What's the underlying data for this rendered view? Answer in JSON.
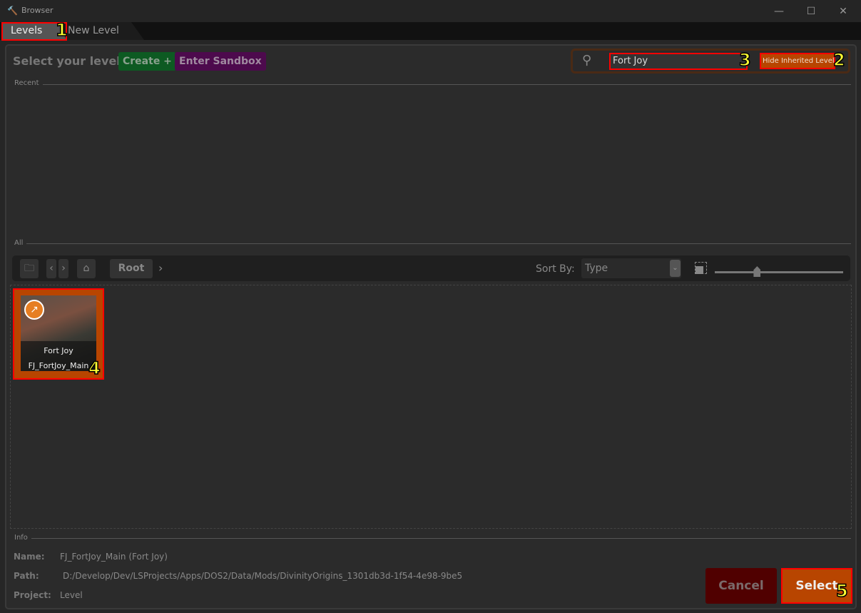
{
  "window": {
    "title": "Browser",
    "controls": [
      "minimize",
      "maximize",
      "close"
    ]
  },
  "tabs": [
    {
      "label": "Levels",
      "active": true
    },
    {
      "label": "New Level",
      "active": false
    }
  ],
  "header": {
    "title": "Select your level",
    "create_label": "Create +",
    "sandbox_label": "Enter Sandbox",
    "create_color": "#0d5a22",
    "sandbox_color": "#4d0a4d"
  },
  "search": {
    "value": "Fort Joy",
    "icon": "search-icon",
    "hide_inherited_label": "Hide Inherited Levels"
  },
  "sections": {
    "recent": "Recent",
    "all": "All",
    "info": "Info"
  },
  "toolbar": {
    "breadcrumb": "Root",
    "sort_label": "Sort By:",
    "sort_value": "Type",
    "zoom_slider_value": 0.33
  },
  "items": [
    {
      "title": "Fort Joy",
      "name": "FJ_FortJoy_Main",
      "selected": true
    }
  ],
  "info": {
    "name_label": "Name:",
    "name_value": "FJ_FortJoy_Main (Fort Joy)",
    "path_label": "Path:",
    "path_value": "D:/Develop/Dev/LSProjects/Apps/DOS2/Data/Mods/DivinityOrigins_1301db3d-1f54-4e98-9be5",
    "project_label": "Project:",
    "project_value": "Level"
  },
  "buttons": {
    "cancel": "Cancel",
    "select": "Select"
  },
  "accent": "#b84500",
  "annotations": [
    "1",
    "2",
    "3",
    "4",
    "5"
  ]
}
